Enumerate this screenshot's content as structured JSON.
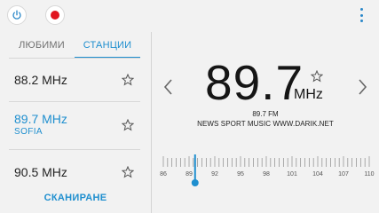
{
  "header": {
    "power_icon": "power-icon",
    "record_icon": "record-icon",
    "menu_icon": "more-vertical-icon",
    "record_color": "#e1141f",
    "accent_color": "#1f8fcf"
  },
  "tabs": [
    {
      "label": "ЛЮБИМИ",
      "selected": false
    },
    {
      "label": "СТАНЦИИ",
      "selected": true
    }
  ],
  "stations": [
    {
      "frequency": "88.2 MHz",
      "name": "",
      "active": false
    },
    {
      "frequency": "89.7 MHz",
      "name": "SOFIA",
      "active": true
    },
    {
      "frequency": "90.5 MHz",
      "name": "",
      "active": false
    }
  ],
  "scan_label": "СКАНИРАНЕ",
  "player": {
    "frequency": "89.7",
    "unit": "MHz",
    "sub_frequency": "89.7 FM",
    "rds_text": "NEWS SPORT MUSIC WWW.DARIK.NET",
    "favorite": false
  },
  "tuner": {
    "min": 86,
    "max": 110,
    "current": 89.7,
    "labels": [
      "86",
      "89",
      "92",
      "95",
      "98",
      "101",
      "104",
      "107",
      "110"
    ],
    "label_values": [
      86,
      89,
      92,
      95,
      98,
      101,
      104,
      107,
      110
    ]
  }
}
